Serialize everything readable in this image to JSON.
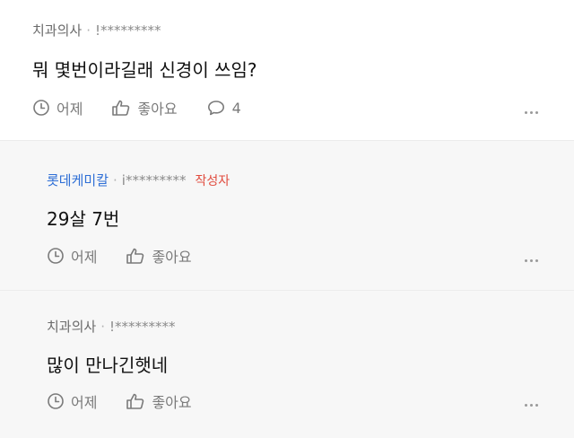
{
  "comments": [
    {
      "author": "치과의사",
      "separator": "·",
      "user_id": "!*********",
      "text": "뭐 몇번이라길래 신경이 쓰임?",
      "time": "어제",
      "like_label": "좋아요",
      "reply_count": "4",
      "more_icon": "more-dots-icon"
    },
    {
      "author": "롯데케미칼",
      "separator": "·",
      "user_id": "i*********",
      "badge": "작성자",
      "text": "29살 7번",
      "time": "어제",
      "like_label": "좋아요",
      "more_icon": "more-dots-icon"
    },
    {
      "author": "치과의사",
      "separator": "·",
      "user_id": "!*********",
      "text": "많이 만나긴햇네",
      "time": "어제",
      "like_label": "좋아요",
      "more_icon": "more-dots-icon"
    }
  ],
  "colors": {
    "reply_background": "#f7f7f7",
    "reply_author": "#2f6fd6",
    "author_badge": "#e14c3f",
    "muted_text": "#7a7a7a"
  }
}
